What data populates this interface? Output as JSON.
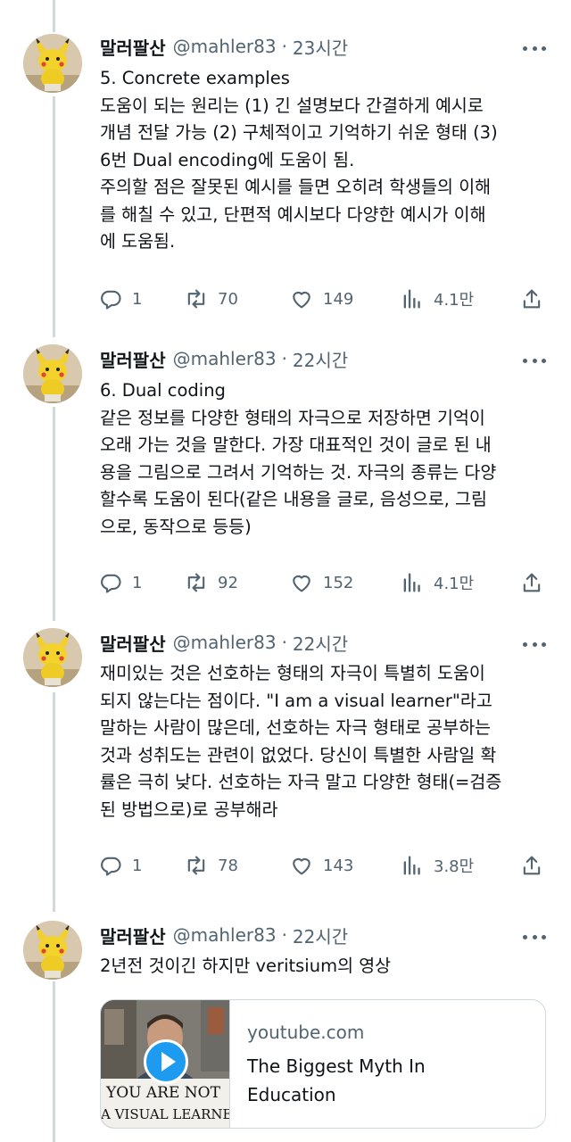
{
  "tweets": [
    {
      "name": "말러팔산",
      "handle": "@mahler83",
      "time": "23시간",
      "lines": [
        "5. Concrete examples",
        "도움이 되는 원리는 (1) 긴 설명보다 간결하게 예시로",
        "개념 전달 가능 (2) 구체적이고 기억하기 쉬운 형태 (3)",
        "6번 Dual encoding에 도움이 됨.",
        "주의할 점은 잘못된 예시를 들면 오히려 학생들의 이해",
        "를 해칠 수 있고, 단편적 예시보다 다양한 예시가 이해",
        "에 도움됨."
      ],
      "replies": "1",
      "retweets": "70",
      "likes": "149",
      "views": "4.1만"
    },
    {
      "name": "말러팔산",
      "handle": "@mahler83",
      "time": "22시간",
      "lines": [
        "6. Dual coding",
        "같은 정보를 다양한 형태의 자극으로 저장하면 기억이",
        "오래 가는 것을 말한다. 가장 대표적인 것이 글로 된 내",
        "용을 그림으로 그려서 기억하는 것. 자극의 종류는 다양",
        "할수록 도움이 된다(같은 내용을 글로, 음성으로, 그림",
        "으로, 동작으로 등등)"
      ],
      "replies": "1",
      "retweets": "92",
      "likes": "152",
      "views": "4.1만"
    },
    {
      "name": "말러팔산",
      "handle": "@mahler83",
      "time": "22시간",
      "lines": [
        "재미있는 것은 선호하는 형태의 자극이 특별히 도움이",
        "되지 않는다는 점이다. \"I am a visual learner\"라고",
        "말하는 사람이 많은데, 선호하는 자극 형태로 공부하는",
        "것과 성취도는 관련이 없었다. 당신이 특별한 사람일 확",
        "률은 극히 낮다. 선호하는 자극 말고 다양한 형태(=검증",
        "된 방법으로)로 공부해라"
      ],
      "replies": "1",
      "retweets": "78",
      "likes": "143",
      "views": "3.8만"
    },
    {
      "name": "말러팔산",
      "handle": "@mahler83",
      "time": "22시간",
      "lines": [
        "2년전 것이긴 하지만 veritsium의 영상"
      ]
    }
  ],
  "link_card": {
    "domain": "youtube.com",
    "title_line1": "The Biggest Myth In",
    "title_line2": "Education",
    "thumbnail_sign_line1": "YOU ARE NOT",
    "thumbnail_sign_line2": "A VISUAL LEARNER"
  },
  "colors": {
    "text": "#0f1419",
    "secondary": "#536471",
    "border": "#cfd9de",
    "accent": "#1d9bf0"
  },
  "icons": {
    "reply": "reply-icon",
    "retweet": "retweet-icon",
    "like": "heart-icon",
    "views": "views-icon",
    "share": "share-icon",
    "more": "more-icon",
    "play": "play-icon"
  }
}
